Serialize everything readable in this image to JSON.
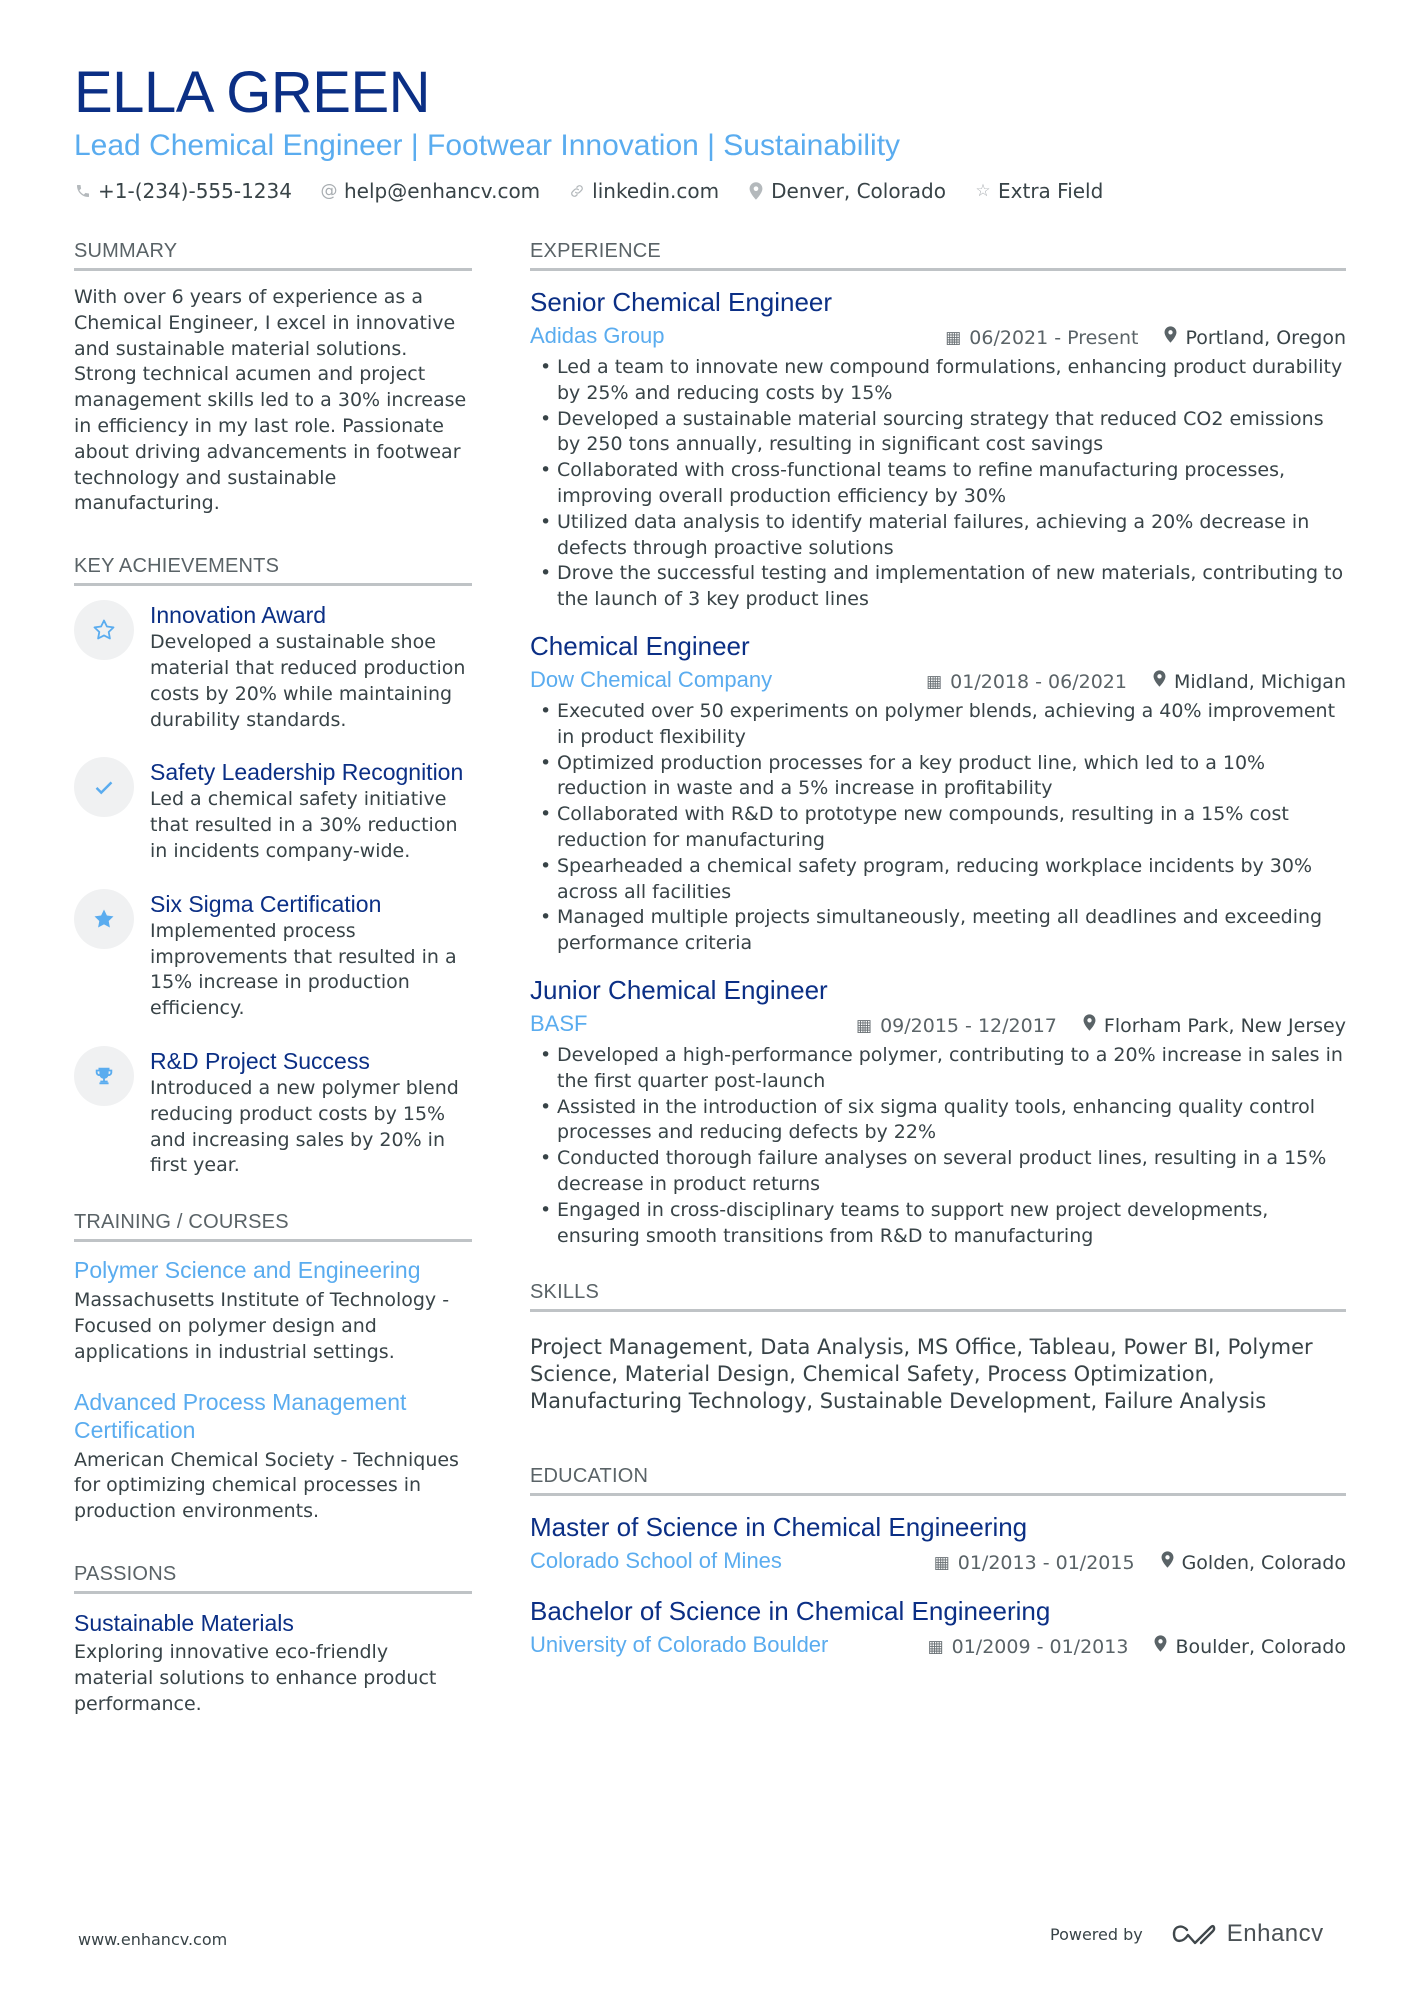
{
  "header": {
    "name": "ELLA GREEN",
    "subtitle": "Lead Chemical Engineer | Footwear Innovation | Sustainability",
    "contacts": [
      {
        "icon": "phone-icon",
        "text": "+1-(234)-555-1234"
      },
      {
        "icon": "at-icon",
        "text": "help@enhancv.com"
      },
      {
        "icon": "link-icon",
        "text": "linkedin.com"
      },
      {
        "icon": "location-pin-icon",
        "text": "Denver, Colorado"
      },
      {
        "icon": "star-outline-icon",
        "text": "Extra Field"
      }
    ]
  },
  "summary": {
    "title": "SUMMARY",
    "text": "With over 6 years of experience as a Chemical Engineer, I excel in innovative and sustainable material solutions. Strong technical acumen and project management skills led to a 30% increase in efficiency in my last role. Passionate about driving advancements in footwear technology and sustainable manufacturing."
  },
  "achievements": {
    "title": "KEY ACHIEVEMENTS",
    "items": [
      {
        "icon": "star-outline-icon",
        "title": "Innovation Award",
        "text": "Developed a sustainable shoe material that reduced production costs by 20% while maintaining durability standards."
      },
      {
        "icon": "checkmark-icon",
        "title": "Safety Leadership Recognition",
        "text": "Led a chemical safety initiative that resulted in a 30% reduction in incidents company-wide."
      },
      {
        "icon": "star-filled-icon",
        "title": "Six Sigma Certification",
        "text": "Implemented process improvements that resulted in a 15% increase in production efficiency."
      },
      {
        "icon": "trophy-icon",
        "title": "R&D Project Success",
        "text": "Introduced a new polymer blend reducing product costs by 15% and increasing sales by 20% in first year."
      }
    ]
  },
  "training": {
    "title": "TRAINING / COURSES",
    "items": [
      {
        "title": "Polymer Science and Engineering",
        "text": "Massachusetts Institute of Technology - Focused on polymer design and applications in industrial settings."
      },
      {
        "title": "Advanced Process Management Certification",
        "text": "American Chemical Society - Techniques for optimizing chemical processes in production environments."
      }
    ]
  },
  "passions": {
    "title": "PASSIONS",
    "items": [
      {
        "title": "Sustainable Materials",
        "text": "Exploring innovative eco-friendly material solutions to enhance product performance."
      }
    ]
  },
  "experience": {
    "title": "EXPERIENCE",
    "jobs": [
      {
        "title": "Senior Chemical Engineer",
        "company": "Adidas Group",
        "dates": "06/2021 - Present",
        "location": "Portland, Oregon",
        "bullets": [
          "Led a team to innovate new compound formulations, enhancing product durability by 25% and reducing costs by 15%",
          "Developed a sustainable material sourcing strategy that reduced CO2 emissions by 250 tons annually, resulting in significant cost savings",
          "Collaborated with cross-functional teams to refine manufacturing processes, improving overall production efficiency by 30%",
          "Utilized data analysis to identify material failures, achieving a 20% decrease in defects through proactive solutions",
          "Drove the successful testing and implementation of new materials, contributing to the launch of 3 key product lines"
        ]
      },
      {
        "title": "Chemical Engineer",
        "company": "Dow Chemical Company",
        "dates": "01/2018 - 06/2021",
        "location": "Midland, Michigan",
        "bullets": [
          "Executed over 50 experiments on polymer blends, achieving a 40% improvement in product flexibility",
          "Optimized production processes for a key product line, which led to a 10% reduction in waste and a 5% increase in profitability",
          "Collaborated with R&D to prototype new compounds, resulting in a 15% cost reduction for manufacturing",
          "Spearheaded a chemical safety program, reducing workplace incidents by 30% across all facilities",
          "Managed multiple projects simultaneously, meeting all deadlines and exceeding performance criteria"
        ]
      },
      {
        "title": "Junior Chemical Engineer",
        "company": "BASF",
        "dates": "09/2015 - 12/2017",
        "location": "Florham Park, New Jersey",
        "bullets": [
          "Developed a high-performance polymer, contributing to a 20% increase in sales in the first quarter post-launch",
          "Assisted in the introduction of six sigma quality tools, enhancing quality control processes and reducing defects by 22%",
          "Conducted thorough failure analyses on several product lines, resulting in a 15% decrease in product returns",
          "Engaged in cross-disciplinary teams to support new project developments, ensuring smooth transitions from R&D to manufacturing"
        ]
      }
    ]
  },
  "skills": {
    "title": "SKILLS",
    "text": "Project Management, Data Analysis, MS Office, Tableau, Power BI, Polymer Science, Material Design, Chemical Safety, Process Optimization, Manufacturing Technology, Sustainable Development, Failure Analysis"
  },
  "education": {
    "title": "EDUCATION",
    "items": [
      {
        "degree": "Master of Science in Chemical Engineering",
        "school": "Colorado School of Mines",
        "dates": "01/2013 - 01/2015",
        "location": "Golden, Colorado"
      },
      {
        "degree": "Bachelor of Science in Chemical Engineering",
        "school": "University of Colorado Boulder",
        "dates": "01/2009 - 01/2013",
        "location": "Boulder, Colorado"
      }
    ]
  },
  "footer": {
    "website": "www.enhancv.com",
    "powered_by": "Powered by",
    "brand": "Enhancv"
  },
  "colors": {
    "primary": "#0b2f85",
    "accent": "#5aacef",
    "text": "#384347",
    "rule": "#bfc3c6",
    "icon_bg": "#f0f1f2"
  }
}
